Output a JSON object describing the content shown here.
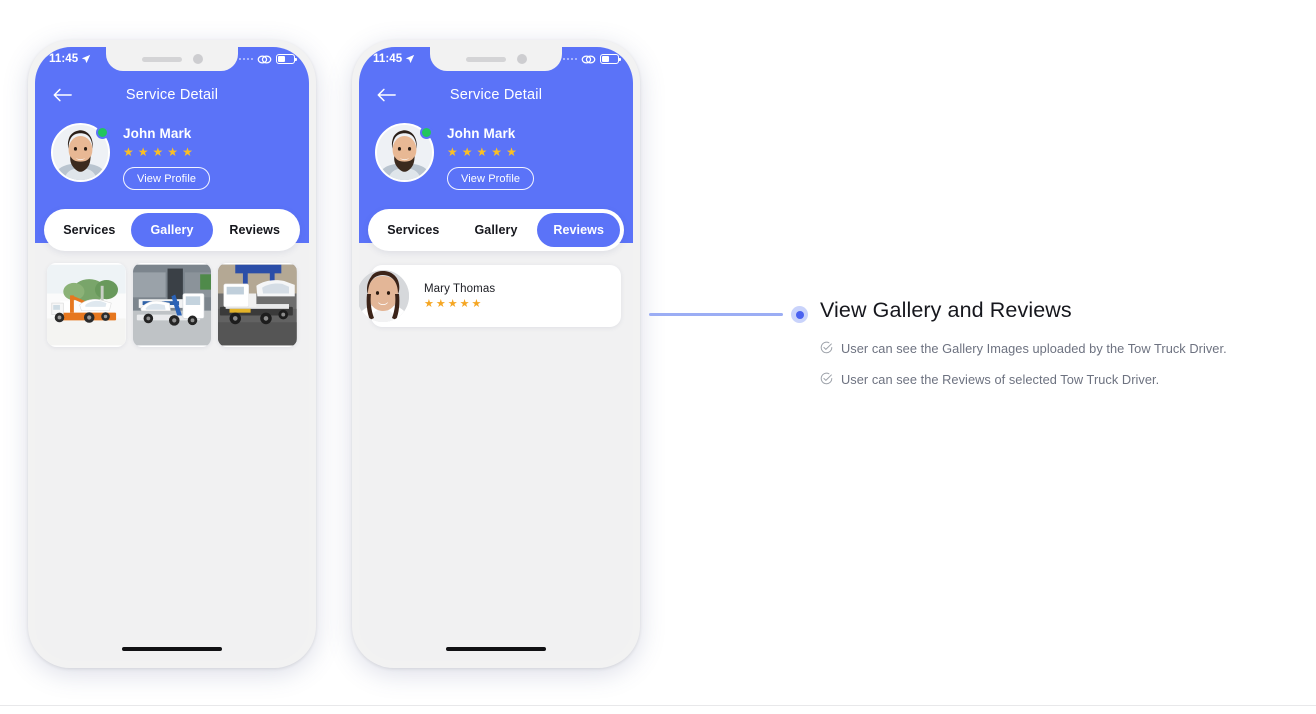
{
  "phones": [
    {
      "id": "gallery-phone",
      "status_bar": {
        "time": "11:45",
        "location_icon": "location-arrow-icon",
        "signal_icon": "signal-dots-icon",
        "network_icon": "link-icon",
        "battery_icon": "battery-icon"
      },
      "nav": {
        "back_icon": "back-arrow-icon",
        "title": "Service Detail"
      },
      "profile": {
        "avatar_icon": "user-avatar",
        "online_status": "online",
        "name": "John Mark",
        "rating": 5,
        "stars": [
          "★",
          "★",
          "★",
          "★",
          "★"
        ],
        "view_profile_label": "View Profile"
      },
      "tabs": [
        {
          "label": "Services",
          "active": false
        },
        {
          "label": "Gallery",
          "active": true
        },
        {
          "label": "Reviews",
          "active": false
        }
      ],
      "content_type": "gallery",
      "gallery": [
        {
          "caption": "tow-truck-sedan-white-background"
        },
        {
          "caption": "tow-truck-loading-white-car-at-depot"
        },
        {
          "caption": "tow-truck-carrying-white-suv"
        }
      ]
    },
    {
      "id": "reviews-phone",
      "status_bar": {
        "time": "11:45",
        "location_icon": "location-arrow-icon",
        "signal_icon": "signal-dots-icon",
        "network_icon": "link-icon",
        "battery_icon": "battery-icon"
      },
      "nav": {
        "back_icon": "back-arrow-icon",
        "title": "Service Detail"
      },
      "profile": {
        "avatar_icon": "user-avatar",
        "online_status": "online",
        "name": "John Mark",
        "rating": 5,
        "stars": [
          "★",
          "★",
          "★",
          "★",
          "★"
        ],
        "view_profile_label": "View Profile"
      },
      "tabs": [
        {
          "label": "Services",
          "active": false
        },
        {
          "label": "Gallery",
          "active": false
        },
        {
          "label": "Reviews",
          "active": true
        }
      ],
      "content_type": "reviews",
      "reviews": [
        {
          "name": "Mary Thomas",
          "rating": 5,
          "stars": [
            "★",
            "★",
            "★",
            "★",
            "★"
          ],
          "avatar_icon": "reviewer-avatar"
        }
      ]
    }
  ],
  "annotation": {
    "title": "View Gallery and Reviews",
    "items": [
      {
        "icon": "circle-check-icon",
        "text": "User can see the Gallery Images uploaded by the Tow Truck Driver."
      },
      {
        "icon": "circle-check-icon",
        "text": "User can see the Reviews of selected Tow Truck Driver."
      }
    ]
  },
  "colors": {
    "primary": "#5B73F8",
    "accent_dot": "#4A62F0",
    "connector": "#9BADF4",
    "star": "#FBBF24",
    "review_star": "#F5A623",
    "online": "#22C55E",
    "screen_bg": "#F1F1F2",
    "title_text": "#16171D",
    "body_text": "#6D7280"
  }
}
